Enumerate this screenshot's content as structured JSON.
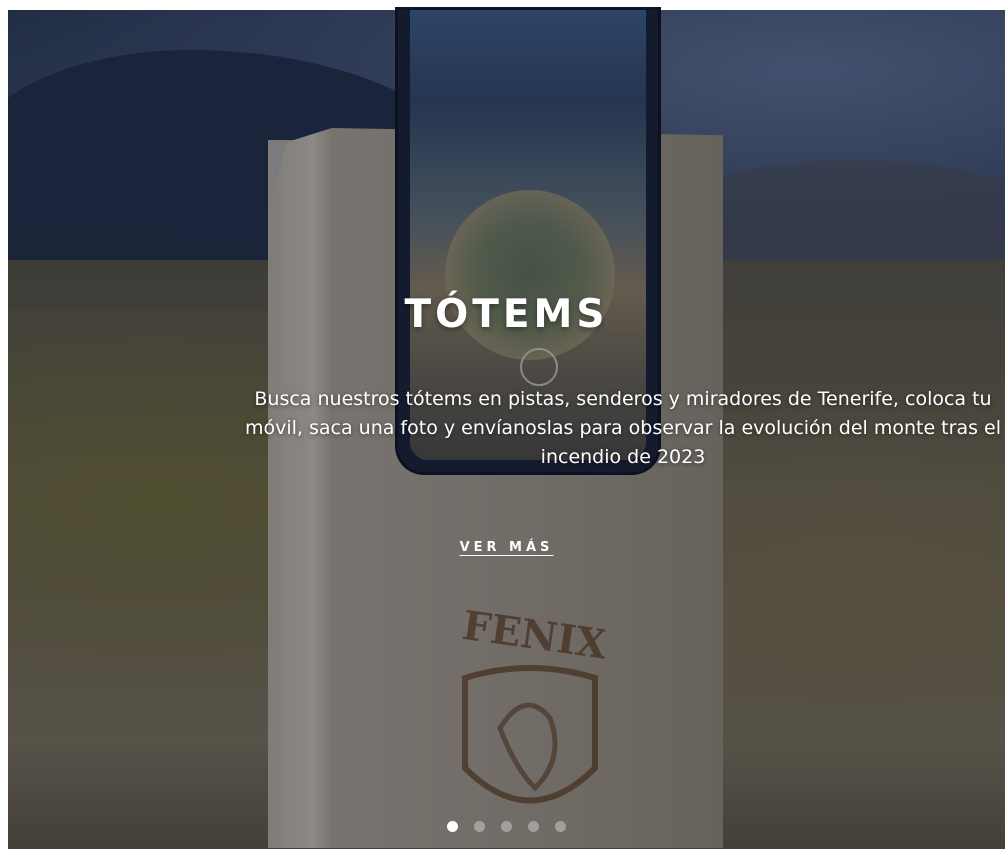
{
  "slide": {
    "title": "TÓTEMS",
    "description": "Busca nuestros tótems en pistas, senderos y miradores de Tenerife, coloca tu móvil, saca una foto y envíanoslas para observar la evolución del monte tras el incendio de 2023",
    "cta_label": "VER MÁS",
    "background_image": "totem-with-phone-photo"
  },
  "carousel": {
    "total_slides": 5,
    "active_index": 0,
    "dot_color": "#ffffff"
  }
}
